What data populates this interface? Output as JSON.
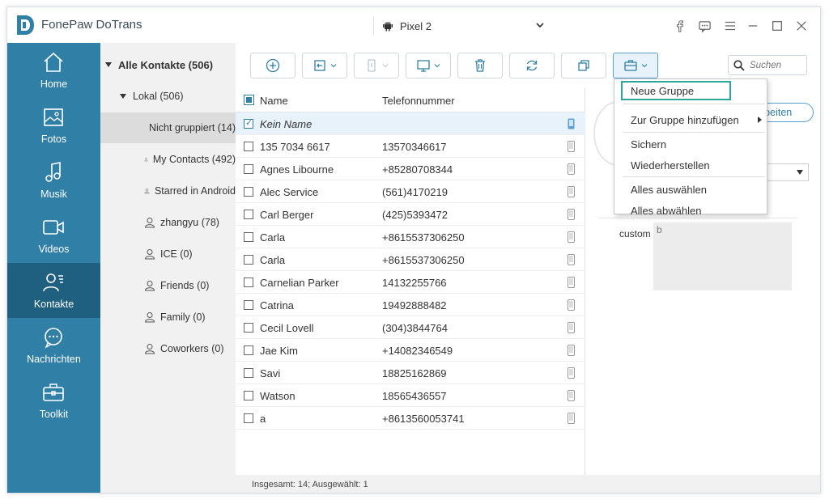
{
  "app": {
    "title": "FonePaw DoTrans"
  },
  "device": {
    "name": "Pixel 2"
  },
  "sidebar": {
    "items": [
      {
        "label": "Home",
        "icon": "home-icon"
      },
      {
        "label": "Fotos",
        "icon": "photo-icon"
      },
      {
        "label": "Musik",
        "icon": "music-icon"
      },
      {
        "label": "Videos",
        "icon": "video-icon"
      },
      {
        "label": "Kontakte",
        "icon": "contacts-icon",
        "active": true
      },
      {
        "label": "Nachrichten",
        "icon": "message-icon"
      },
      {
        "label": "Toolkit",
        "icon": "toolkit-icon"
      }
    ]
  },
  "groups": {
    "all": "Alle Kontakte  (506)",
    "local": "Lokal  (506)",
    "items": [
      {
        "label": "Nicht gruppiert  (14)"
      },
      {
        "label": "My Contacts  (492)"
      },
      {
        "label": "Starred in Android"
      },
      {
        "label": "zhangyu  (78)"
      },
      {
        "label": "ICE  (0)"
      },
      {
        "label": "Friends  (0)"
      },
      {
        "label": "Family  (0)"
      },
      {
        "label": "Coworkers  (0)"
      }
    ]
  },
  "search": {
    "placeholder": "Suchen"
  },
  "list": {
    "col_name": "Name",
    "col_phone": "Telefonnummer",
    "rows": [
      {
        "name": "Kein Name",
        "phone": "",
        "selected": true
      },
      {
        "name": "135 7034 6617",
        "phone": "13570346617"
      },
      {
        "name": "Agnes Libourne",
        "phone": "+85280708344"
      },
      {
        "name": "Alec Service",
        "phone": "(561)4170219"
      },
      {
        "name": "Carl Berger",
        "phone": "(425)5393472"
      },
      {
        "name": "Carla",
        "phone": "+8615537306250"
      },
      {
        "name": "Carla",
        "phone": "+8615537306250"
      },
      {
        "name": "Carnelian Parker",
        "phone": "14132255766"
      },
      {
        "name": "Catrina",
        "phone": "19492888482"
      },
      {
        "name": "Cecil Lovell",
        "phone": "(304)3844764"
      },
      {
        "name": "Jae Kim",
        "phone": "+14082346549"
      },
      {
        "name": "Savi",
        "phone": "18825162869"
      },
      {
        "name": "Watson",
        "phone": "18565436557"
      },
      {
        "name": "a",
        "phone": "+8613560053741"
      }
    ]
  },
  "status": {
    "text": "Insgesamt: 14; Ausgewählt: 1"
  },
  "detail": {
    "edit_label": "rbeiten",
    "custom_label": "custom",
    "custom_value": "b"
  },
  "menu": {
    "new_group": "Neue Gruppe",
    "add_to_group": "Zur Gruppe hinzufügen",
    "backup": "Sichern",
    "restore": "Wiederherstellen",
    "select_all": "Alles auswählen",
    "deselect_all": "Alles abwählen"
  },
  "colors": {
    "sidebar": "#2f7fa6",
    "sidebar_active": "#1f5f80",
    "highlight": "#2ba89b",
    "accent": "#5b9fd0"
  }
}
